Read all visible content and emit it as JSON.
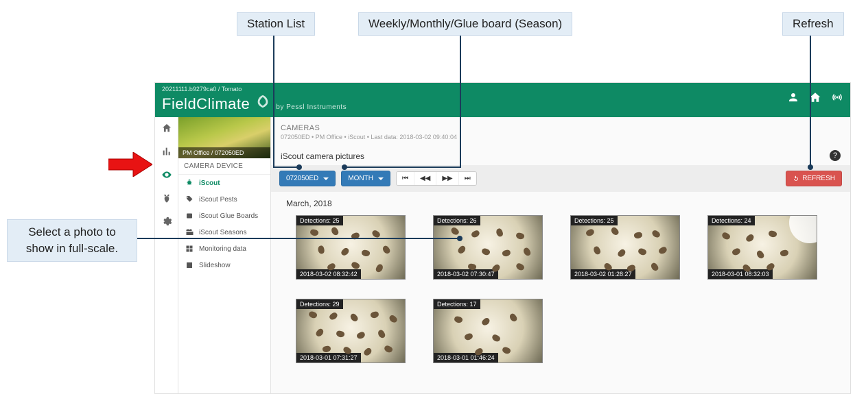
{
  "annotations": {
    "station_list": "Station List",
    "period": "Weekly/Monthly/Glue board (Season)",
    "refresh": "Refresh",
    "select_photo": "Select a photo to show in full-scale."
  },
  "topbar": {
    "breadcrumb": "20211111.b9279ca0 / Tomato",
    "logo_main": "FieldClimate",
    "logo_sub": "by Pessl Instruments"
  },
  "sidepanel": {
    "hero_label": "PM Office / 072050ED",
    "section": "CAMERA DEVICE",
    "items": [
      {
        "label": "iScout"
      },
      {
        "label": "iScout Pests"
      },
      {
        "label": "iScout Glue Boards"
      },
      {
        "label": "iScout Seasons"
      },
      {
        "label": "Monitoring data"
      },
      {
        "label": "Slideshow"
      }
    ]
  },
  "main": {
    "heading": "CAMERAS",
    "subheading": "072050ED • PM Office • iScout • Last data: 2018-03-02 09:40:04",
    "section_title": "iScout camera pictures"
  },
  "toolbar": {
    "station_btn": "072050ED",
    "period_btn": "MONTH",
    "refresh_btn": "REFRESH"
  },
  "period_label": "March, 2018",
  "thumbs": [
    {
      "det": "Detections: 25",
      "ts": "2018-03-02 08:32:42"
    },
    {
      "det": "Detections: 26",
      "ts": "2018-03-02 07:30:47"
    },
    {
      "det": "Detections: 25",
      "ts": "2018-03-02 01:28:27"
    },
    {
      "det": "Detections: 24",
      "ts": "2018-03-01 08:32:03"
    },
    {
      "det": "Detections: 29",
      "ts": "2018-03-01 07:31:27"
    },
    {
      "det": "Detections: 17",
      "ts": "2018-03-01 01:46:24"
    }
  ]
}
